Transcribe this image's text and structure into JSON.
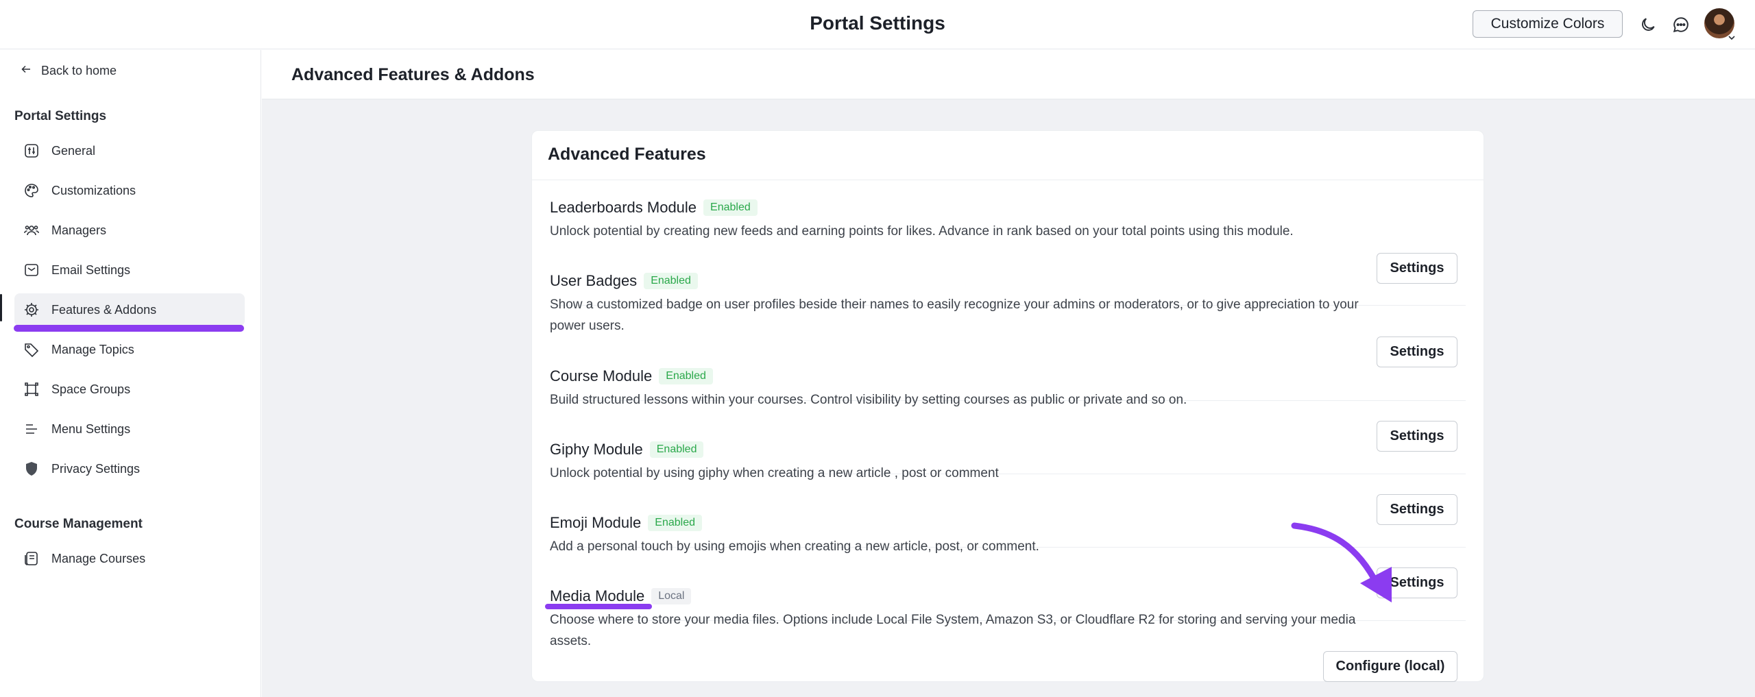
{
  "header": {
    "title": "Portal Settings",
    "customize_label": "Customize Colors"
  },
  "sidebar": {
    "back_label": "Back to home",
    "portal_section": "Portal Settings",
    "items": [
      {
        "label": "General"
      },
      {
        "label": "Customizations"
      },
      {
        "label": "Managers"
      },
      {
        "label": "Email Settings"
      },
      {
        "label": "Features & Addons"
      },
      {
        "label": "Manage Topics"
      },
      {
        "label": "Space Groups"
      },
      {
        "label": "Menu Settings"
      },
      {
        "label": "Privacy Settings"
      }
    ],
    "course_section": "Course Management",
    "course_items": [
      {
        "label": "Manage Courses"
      }
    ]
  },
  "main": {
    "page_title": "Advanced Features & Addons",
    "card_title": "Advanced Features",
    "features": [
      {
        "name": "Leaderboards Module",
        "badge": "Enabled",
        "desc": "Unlock potential by creating new feeds and earning points for likes. Advance in rank based on your total points using this module.",
        "button": "Settings"
      },
      {
        "name": "User Badges",
        "badge": "Enabled",
        "desc": "Show a customized badge on user profiles beside their names to easily recognize your admins or moderators, or to give appreciation to your power users.",
        "button": "Settings"
      },
      {
        "name": "Course Module",
        "badge": "Enabled",
        "desc": "Build structured lessons within your courses. Control visibility by setting courses as public or private and so on.",
        "button": "Settings"
      },
      {
        "name": "Giphy Module",
        "badge": "Enabled",
        "desc": "Unlock potential by using giphy when creating a new article , post or comment",
        "button": "Settings"
      },
      {
        "name": "Emoji Module",
        "badge": "Enabled",
        "desc": "Add a personal touch by using emojis when creating a new article, post, or comment.",
        "button": "Settings"
      },
      {
        "name": "Media Module",
        "badge": "Local",
        "desc": "Choose where to store your media files. Options include Local File System, Amazon S3, or Cloudflare R2 for storing and serving your media assets.",
        "button": "Configure (local)"
      }
    ]
  },
  "colors": {
    "accent": "#8b3cf0",
    "enabled": "#2aa84a"
  }
}
